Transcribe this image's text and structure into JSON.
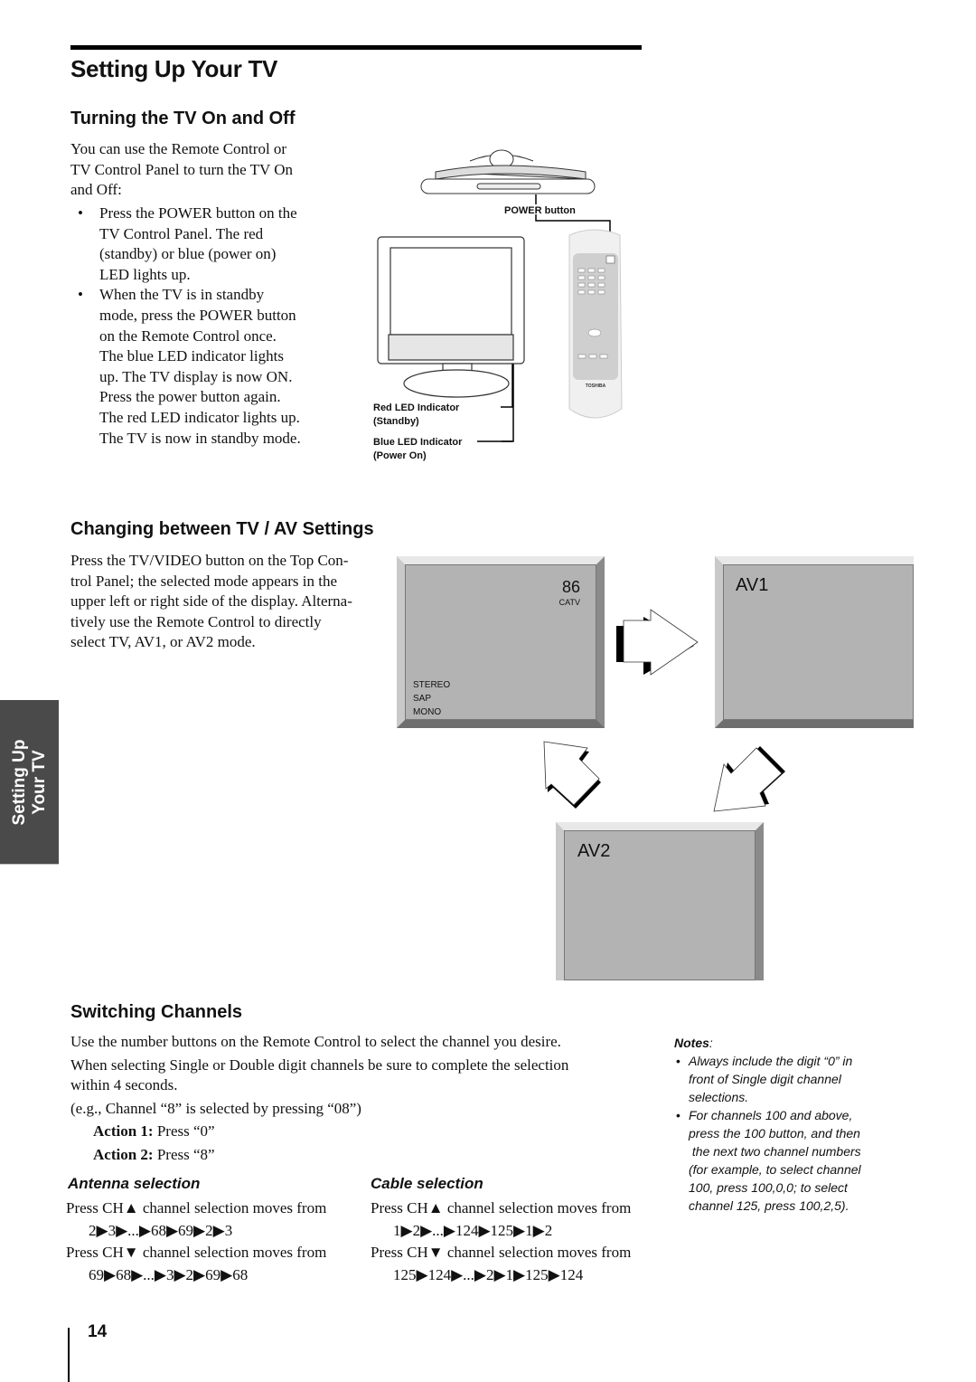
{
  "page": {
    "title": "Setting Up Your TV",
    "number": "14",
    "side_tab": {
      "line1": "Setting Up",
      "line2": "Your TV"
    }
  },
  "turning": {
    "heading": "Turning the TV On and Off",
    "intro_lines": [
      "You can use the Remote Control or",
      "TV Control Panel to turn the TV On",
      "and Off:"
    ],
    "bullets": [
      {
        "lines": [
          "Press the POWER button on the",
          "TV Control Panel. The red",
          "(standby) or blue (power on)",
          "LED lights up."
        ]
      },
      {
        "lines": [
          "When the TV is in standby",
          "mode, press the POWER button",
          "on the Remote Control once.",
          "The blue LED indicator lights",
          "up. The TV display is now ON.",
          "Press the power button again.",
          "The red LED indicator lights up.",
          "The TV is now in standby mode."
        ]
      }
    ],
    "diagram": {
      "power_button_label": "POWER button",
      "red_led_label": "Red LED Indicator",
      "red_led_sub": "(Standby)",
      "blue_led_label": "Blue LED Indicator",
      "blue_led_sub": "(Power On)",
      "remote_brand": "TOSHIBA"
    }
  },
  "changing": {
    "heading": "Changing between TV / AV Settings",
    "body_lines": [
      "Press the TV/VIDEO button on the Top Con-",
      "trol Panel; the selected mode appears in the",
      "upper left or right side of the display. Alterna-",
      "tively use the Remote Control to directly",
      "select TV, AV1, or AV2 mode."
    ],
    "screens": {
      "tv": {
        "channel": "86",
        "band": "CATV",
        "audio_modes": [
          "STEREO",
          "SAP",
          "MONO"
        ]
      },
      "av1": {
        "label": "AV1"
      },
      "av2": {
        "label": "AV2"
      }
    },
    "screen_color": "#b3b3b3"
  },
  "switching": {
    "heading": "Switching Channels",
    "para1": "Use the number buttons on the Remote Control to select the channel you desire.",
    "para2_lines": [
      "When selecting Single or Double digit channels be sure to complete the selection",
      "within 4 seconds."
    ],
    "example": "(e.g., Channel “8” is selected by pressing “08”)",
    "actions": [
      {
        "label": "Action 1:",
        "text": " Press “0”"
      },
      {
        "label": "Action 2:",
        "text": " Press “8”"
      }
    ],
    "antenna": {
      "heading": "Antenna selection",
      "up_text": "Press CH▲ channel selection moves from",
      "up_seq": "2▶3▶...▶68▶69▶2▶3",
      "down_text": "Press CH▼ channel selection moves from",
      "down_seq": "69▶68▶...▶3▶2▶69▶68"
    },
    "cable": {
      "heading": "Cable selection",
      "up_text": "Press CH▲ channel selection moves from",
      "up_seq": "1▶2▶...▶124▶125▶1▶2",
      "down_text": "Press CH▼ channel selection moves from",
      "down_seq": "125▶124▶...▶2▶1▶125▶124"
    },
    "notes": {
      "heading": "Notes",
      "items": [
        {
          "lines": [
            "Always include the digit “0” in",
            "front of Single digit channel",
            "selections."
          ]
        },
        {
          "lines": [
            "For channels 100 and above,",
            "press the 100 button, and then",
            " the next two channel numbers",
            "(for example, to select channel",
            "100, press 100,0,0; to select",
            "channel 125, press 100,2,5)."
          ]
        }
      ]
    }
  }
}
